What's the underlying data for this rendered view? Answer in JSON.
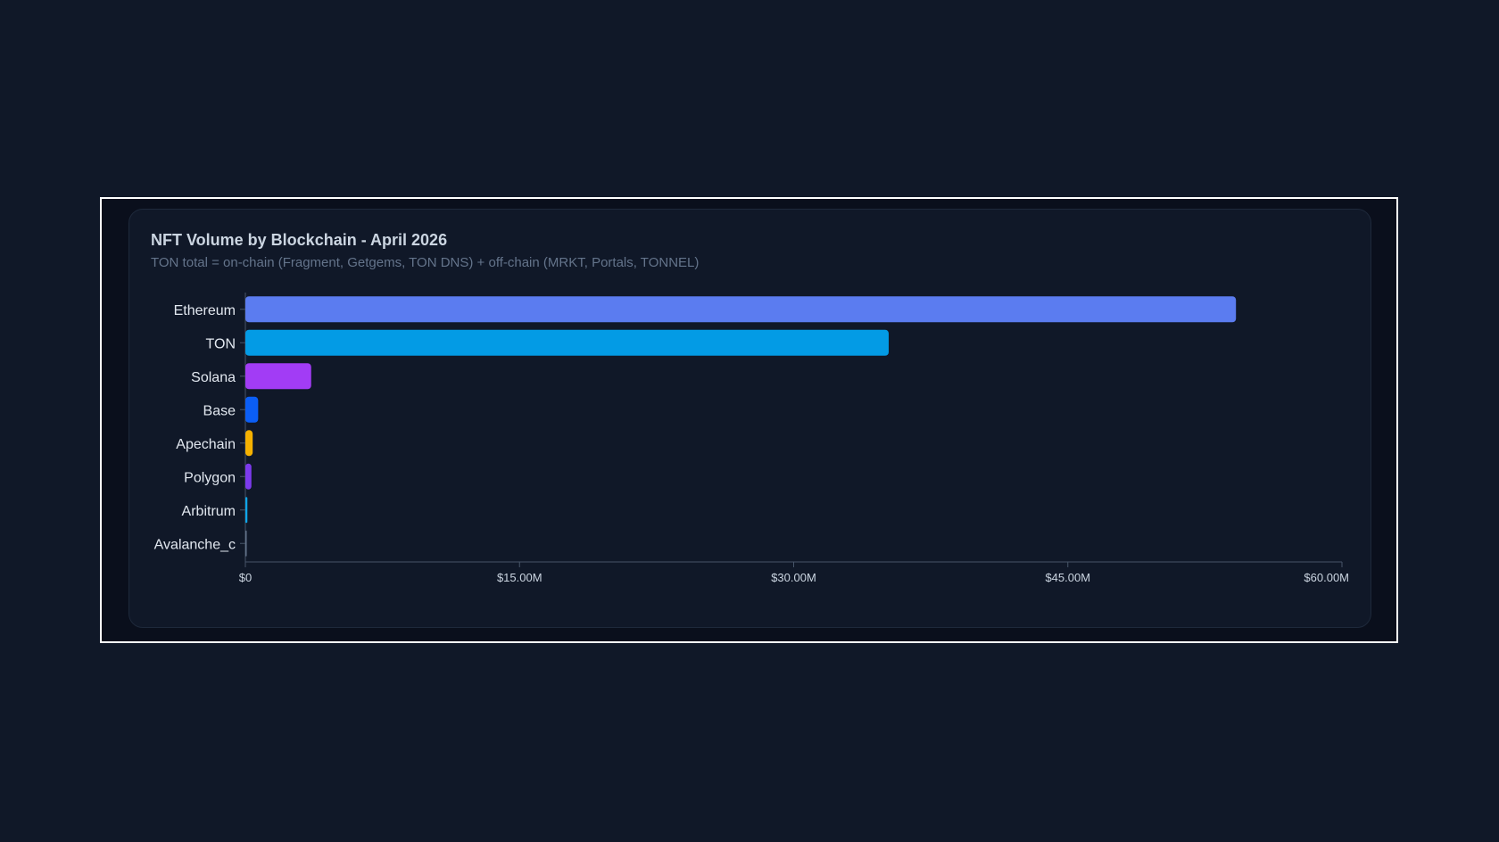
{
  "chart_data": {
    "type": "bar",
    "orientation": "horizontal",
    "title": "NFT Volume by Blockchain - April 2026",
    "subtitle": "TON total = on-chain (Fragment, Getgems, TON DNS) + off-chain (MRKT, Portals, TONNEL)",
    "xlabel": "",
    "ylabel": "",
    "categories": [
      "Ethereum",
      "TON",
      "Solana",
      "Base",
      "Apechain",
      "Polygon",
      "Arbitrum",
      "Avalanche_c"
    ],
    "values": [
      54200000,
      35200000,
      3600000,
      700000,
      400000,
      330000,
      110000,
      10000
    ],
    "colors": [
      "#5b7cf0",
      "#039be5",
      "#a23cf5",
      "#0b5ef5",
      "#f5b100",
      "#7c3aed",
      "#0ea5e9",
      "#64748b"
    ],
    "xlim": [
      0,
      60000000
    ],
    "x_ticks": [
      0,
      15000000,
      30000000,
      45000000,
      60000000
    ],
    "x_tick_labels": [
      "$0",
      "$15.00M",
      "$30.00M",
      "$45.00M",
      "$60.00M"
    ],
    "grid": false,
    "legend": "none"
  }
}
